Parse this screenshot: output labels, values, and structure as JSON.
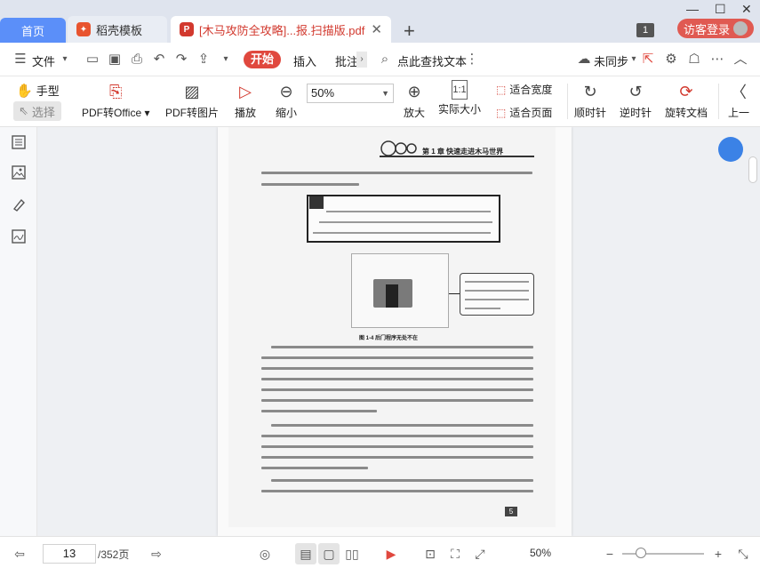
{
  "tabs": {
    "home": "首页",
    "daoke": "稻壳模板",
    "pdf": "[木马攻防全攻略]...报.扫描版.pdf"
  },
  "window": {
    "badge": "1",
    "visitor_login": "访客登录"
  },
  "menubar": {
    "file": "文件",
    "start": "开始",
    "insert": "插入",
    "annotate": "批注",
    "search": "点此查找文本",
    "sync": "未同步"
  },
  "toolbar": {
    "hand": "手型",
    "select": "选择",
    "pdf_to_office": "PDF转Office",
    "pdf_to_image": "PDF转图片",
    "play": "播放",
    "zoom_out": "缩小",
    "zoom_value": "50%",
    "zoom_in": "放大",
    "actual_size": "实际大小",
    "fit_width": "适合宽度",
    "fit_page": "适合页面",
    "rotate_cw": "顺时针",
    "rotate_ccw": "逆时针",
    "rotate_doc": "旋转文档",
    "prev": "上一"
  },
  "document": {
    "chapter_header": "第 1 章  快速走进木马世界",
    "figure_caption": "图 1-4  后门程序无处不在",
    "page_number": "5"
  },
  "statusbar": {
    "current_page": "13",
    "total_pages": "/352页",
    "zoom": "50%"
  },
  "colors": {
    "accent": "#e0483e",
    "tab_home": "#5b8ff9",
    "float_button": "#3b82e6"
  }
}
